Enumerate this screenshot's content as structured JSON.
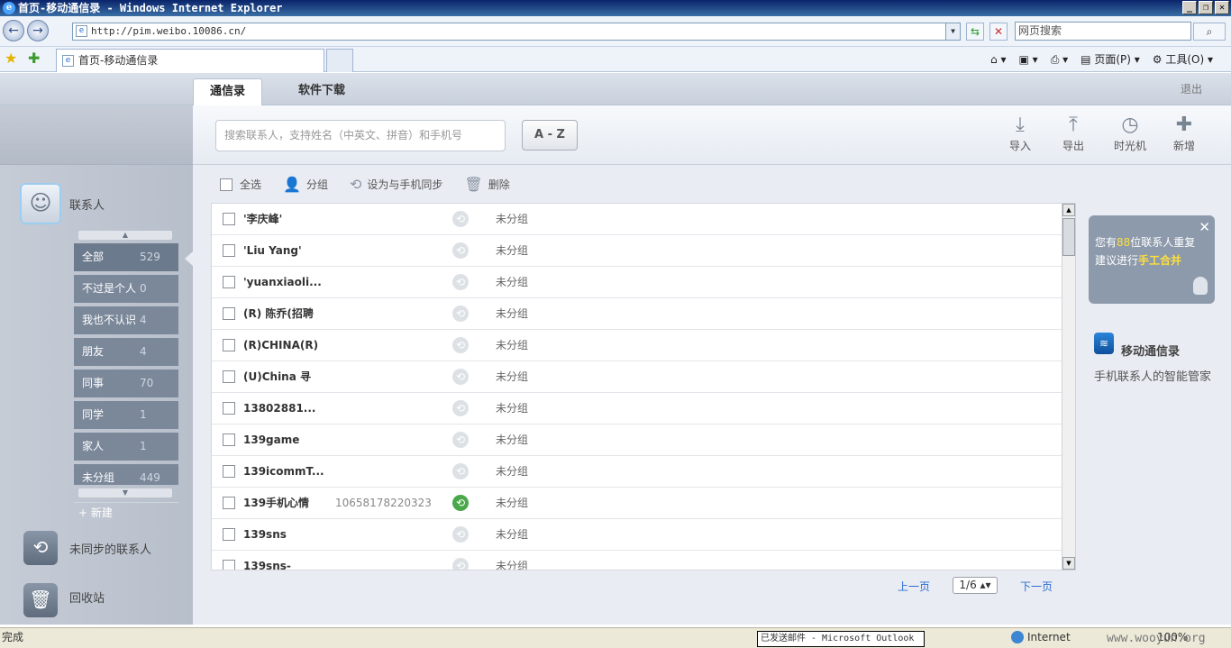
{
  "window": {
    "title": "首页-移动通信录 - Windows Internet Explorer",
    "buttons": [
      "_",
      "❐",
      "✕"
    ]
  },
  "browser": {
    "url": "http://pim.weibo.10086.cn/",
    "search_placeholder": "网页搜索",
    "tab_title": "首页-移动通信录",
    "cmd_page": "页面(P)",
    "cmd_tools": "工具(O)"
  },
  "app": {
    "tabs": [
      {
        "label": "通信录"
      },
      {
        "label": "软件下载"
      }
    ],
    "logout": "退出",
    "search_placeholder": "搜索联系人，支持姓名（中英文、拼音）和手机号",
    "az_label": "A - Z",
    "tools": [
      {
        "label": "导入",
        "icon": "import-icon"
      },
      {
        "label": "导出",
        "icon": "export-icon"
      },
      {
        "label": "时光机",
        "icon": "clock-icon"
      },
      {
        "label": "新增",
        "icon": "plus-icon"
      }
    ]
  },
  "sidebar": {
    "contacts_label": "联系人",
    "groups": [
      {
        "label": "全部",
        "count": "529"
      },
      {
        "label": "不过是个人",
        "count": "0"
      },
      {
        "label": "我也不认识",
        "count": "4"
      },
      {
        "label": "朋友",
        "count": "4"
      },
      {
        "label": "同事",
        "count": "70"
      },
      {
        "label": "同学",
        "count": "1"
      },
      {
        "label": "家人",
        "count": "1"
      },
      {
        "label": "未分组",
        "count": "449"
      }
    ],
    "new_group": "+ 新建",
    "unsynced_label": "未同步的联系人",
    "recycle_label": "回收站"
  },
  "actions": {
    "select_all": "全选",
    "group": "分组",
    "sync": "设为与手机同步",
    "delete": "删除"
  },
  "contacts": [
    {
      "name": "'李庆峰'",
      "phone": "",
      "group": "未分组",
      "synced": false
    },
    {
      "name": "'Liu Yang'",
      "phone": "",
      "group": "未分组",
      "synced": false
    },
    {
      "name": "'yuanxiaoli...",
      "phone": "",
      "group": "未分组",
      "synced": false
    },
    {
      "name": "(R) 陈乔(招聘",
      "phone": "",
      "group": "未分组",
      "synced": false
    },
    {
      "name": "(R)CHINA(R)",
      "phone": "",
      "group": "未分组",
      "synced": false
    },
    {
      "name": "(U)China 寻",
      "phone": "",
      "group": "未分组",
      "synced": false
    },
    {
      "name": "13802881...",
      "phone": "",
      "group": "未分组",
      "synced": false
    },
    {
      "name": "139game",
      "phone": "",
      "group": "未分组",
      "synced": false
    },
    {
      "name": "139icommT...",
      "phone": "",
      "group": "未分组",
      "synced": false
    },
    {
      "name": "139手机心情",
      "phone": "10658178220323",
      "group": "未分组",
      "synced": true
    },
    {
      "name": "139sns",
      "phone": "",
      "group": "未分组",
      "synced": false
    },
    {
      "name": "139sns-",
      "phone": "",
      "group": "未分组",
      "synced": false
    }
  ],
  "pager": {
    "prev": "上一页",
    "page": "1/6 ▴▾",
    "next": "下一页"
  },
  "notice": {
    "line1_pre": "您有",
    "count": "88",
    "line1_post": "位联系人重复",
    "line2_pre": "建议进行",
    "action": "手工合并"
  },
  "brand": {
    "name": "移动通信录",
    "slogan": "手机联系人的智能管家"
  },
  "status": {
    "done": "完成",
    "zone": "Internet",
    "zoom": "100%",
    "task": "已发送邮件 - Microsoft Outlook"
  },
  "watermark": "www.wooyun.org"
}
